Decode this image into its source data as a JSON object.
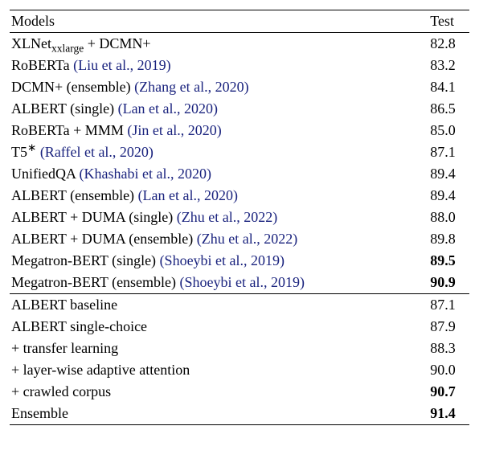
{
  "headers": {
    "models": "Models",
    "test": "Test"
  },
  "rows_upper": [
    {
      "model_pre": "XLNet",
      "model_sub": "xxlarge",
      "model_post": " + DCMN+",
      "cite": "",
      "test": "82.8",
      "bold": false
    },
    {
      "model_pre": "RoBERTa ",
      "cite": "(Liu et al., 2019)",
      "test": "83.2",
      "bold": false
    },
    {
      "model_pre": "DCMN+ (ensemble) ",
      "cite": "(Zhang et al., 2020)",
      "test": "84.1",
      "bold": false
    },
    {
      "model_pre": "ALBERT (single) ",
      "cite": "(Lan et al., 2020)",
      "test": "86.5",
      "bold": false
    },
    {
      "model_pre": "RoBERTa + MMM ",
      "cite": "(Jin et al., 2020)",
      "test": "85.0",
      "bold": false
    },
    {
      "model_pre": "T5",
      "model_sup": "∗",
      "model_post": " ",
      "cite": "(Raffel et al., 2020)",
      "test": "87.1",
      "bold": false
    },
    {
      "model_pre": "UnifiedQA ",
      "cite": "(Khashabi et al., 2020)",
      "test": "89.4",
      "bold": false
    },
    {
      "model_pre": "ALBERT (ensemble) ",
      "cite": "(Lan et al., 2020)",
      "test": "89.4",
      "bold": false
    },
    {
      "model_pre": "ALBERT + DUMA (single) ",
      "cite": "(Zhu et al., 2022)",
      "test": "88.0",
      "bold": false
    },
    {
      "model_pre": "ALBERT + DUMA (ensemble) ",
      "cite": "(Zhu et al., 2022)",
      "test": "89.8",
      "bold": false
    },
    {
      "model_pre": "Megatron-BERT (single) ",
      "cite": "(Shoeybi et al., 2019)",
      "test": "89.5",
      "bold": true
    },
    {
      "model_pre": "Megatron-BERT (ensemble) ",
      "cite": "(Shoeybi et al., 2019)",
      "test": "90.9",
      "bold": true
    }
  ],
  "rows_lower": [
    {
      "model_pre": "ALBERT baseline",
      "test": "87.1",
      "bold": false
    },
    {
      "model_pre": "ALBERT single-choice",
      "test": "87.9",
      "bold": false
    },
    {
      "model_pre": "+ transfer learning",
      "test": "88.3",
      "bold": false
    },
    {
      "model_pre": "+ layer-wise adaptive attention",
      "test": "90.0",
      "bold": false
    },
    {
      "model_pre": "+ crawled corpus",
      "test": "90.7",
      "bold": true
    },
    {
      "model_pre": "Ensemble",
      "test": "91.4",
      "bold": true
    }
  ],
  "chart_data": {
    "type": "table",
    "title": "",
    "columns": [
      "Models",
      "Test"
    ],
    "rows": [
      [
        "XLNet_xxlarge + DCMN+",
        82.8
      ],
      [
        "RoBERTa (Liu et al., 2019)",
        83.2
      ],
      [
        "DCMN+ (ensemble) (Zhang et al., 2020)",
        84.1
      ],
      [
        "ALBERT (single) (Lan et al., 2020)",
        86.5
      ],
      [
        "RoBERTa + MMM (Jin et al., 2020)",
        85.0
      ],
      [
        "T5* (Raffel et al., 2020)",
        87.1
      ],
      [
        "UnifiedQA (Khashabi et al., 2020)",
        89.4
      ],
      [
        "ALBERT (ensemble) (Lan et al., 2020)",
        89.4
      ],
      [
        "ALBERT + DUMA (single) (Zhu et al., 2022)",
        88.0
      ],
      [
        "ALBERT + DUMA (ensemble) (Zhu et al., 2022)",
        89.8
      ],
      [
        "Megatron-BERT (single) (Shoeybi et al., 2019)",
        89.5
      ],
      [
        "Megatron-BERT (ensemble) (Shoeybi et al., 2019)",
        90.9
      ],
      [
        "ALBERT baseline",
        87.1
      ],
      [
        "ALBERT single-choice",
        87.9
      ],
      [
        "+ transfer learning",
        88.3
      ],
      [
        "+ layer-wise adaptive attention",
        90.0
      ],
      [
        "+ crawled corpus",
        90.7
      ],
      [
        "Ensemble",
        91.4
      ]
    ]
  }
}
